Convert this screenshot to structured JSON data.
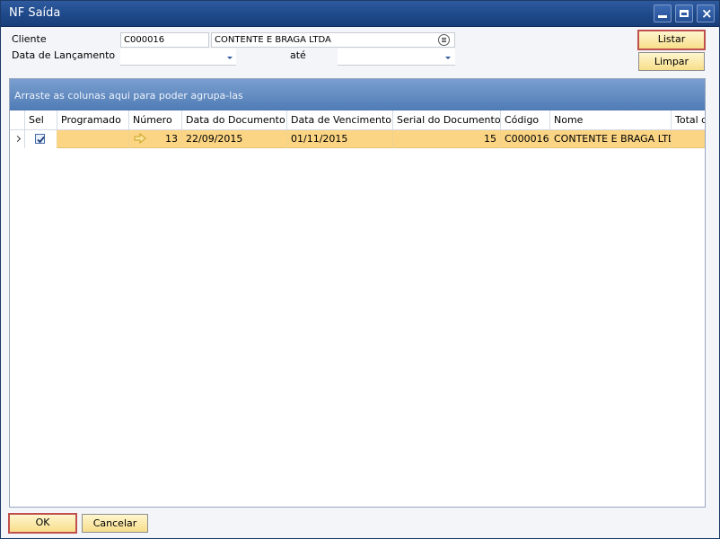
{
  "window": {
    "title": "NF Saída"
  },
  "form": {
    "cliente_label": "Cliente",
    "cliente_code": "C000016",
    "cliente_name": "CONTENTE E BRAGA LTDA",
    "data_lancamento_label": "Data de Lançamento",
    "ate_label": "até",
    "data_from": "",
    "data_to": ""
  },
  "buttons": {
    "listar": "Listar",
    "limpar": "Limpar",
    "ok": "OK",
    "cancelar": "Cancelar"
  },
  "grid": {
    "group_hint": "Arraste as colunas aqui para poder agrupa-las",
    "columns": [
      "Sel",
      "Programado",
      "Número",
      "Data do Documento",
      "Data de Vencimento",
      "Serial do Documento",
      "Código",
      "Nome",
      "Total d"
    ],
    "rows": [
      {
        "sel": true,
        "programado": "",
        "numero": "13",
        "data_documento": "22/09/2015",
        "data_vencimento": "01/11/2015",
        "serial_documento": "15",
        "codigo": "C000016",
        "nome": "CONTENTE E BRAGA LTDA",
        "total": ""
      }
    ]
  },
  "colors": {
    "titlebar": "#1f4a8b",
    "selected_row": "#fbd583",
    "button_face": "#f7de8a",
    "focus_border": "#c0504d"
  },
  "icons": {
    "row_pointer": "chevron-right-icon",
    "link_arrow": "arrow-right-icon",
    "choose_from_list": "list-icon"
  }
}
